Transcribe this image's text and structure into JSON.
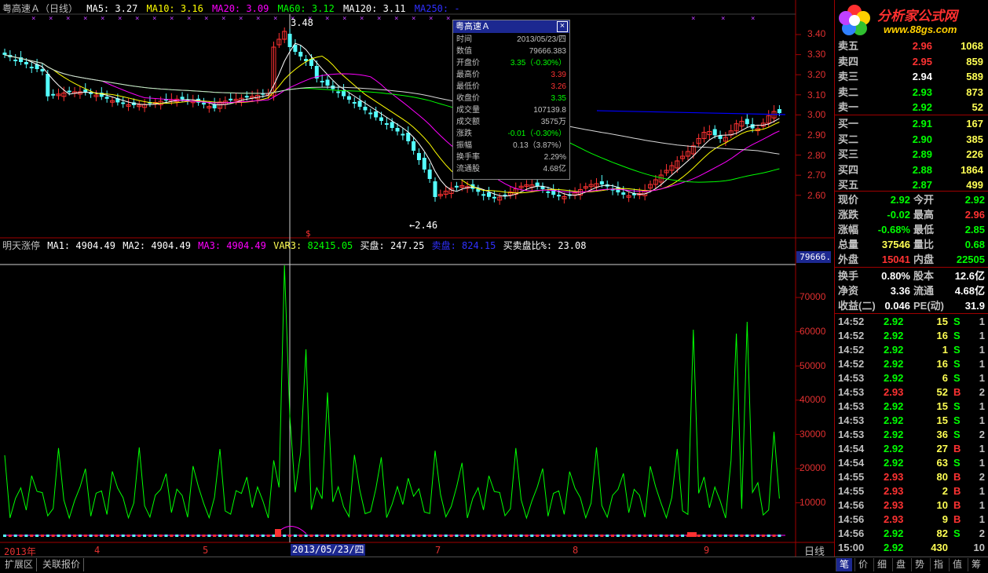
{
  "colors": {
    "up": "#ff3232",
    "down": "#54ffff",
    "ma5": "#ffffff",
    "ma10": "#ffff00",
    "ma20": "#ff00ff",
    "ma60": "#00ff00",
    "ma120": "#ffffff",
    "ma250": "#0000ff",
    "grid": "#a00000"
  },
  "header": {
    "stock": "粤高速Ａ（日线）",
    "ma5_label": "MA5:",
    "ma5": "3.27",
    "ma10_label": "MA10:",
    "ma10": "3.16",
    "ma20_label": "MA20:",
    "ma20": "3.09",
    "ma60_label": "MA60:",
    "ma60": "3.12",
    "ma120_label": "MA120:",
    "ma120": "3.11",
    "ma250_label": "MA250:",
    "ma250": "-"
  },
  "price_axis": [
    "3.40",
    "3.30",
    "3.20",
    "3.10",
    "3.00",
    "2.90",
    "2.80",
    "2.70",
    "2.60"
  ],
  "price_annotations": {
    "high": "3.48",
    "low": "←2.46",
    "marker": "$"
  },
  "indicator": {
    "name": "明天涨停",
    "ma1_label": "MA1:",
    "ma1": "4904.49",
    "ma2_label": "MA2:",
    "ma2": "4904.49",
    "ma3_label": "MA3:",
    "ma3": "4904.49",
    "var3_label": "VAR3:",
    "var3": "82415.05",
    "buy_label": "买盘:",
    "buy": "247.25",
    "sell_label": "卖盘:",
    "sell": "824.15",
    "ratio_label": "买卖盘比%:",
    "ratio": "23.08"
  },
  "indicator_axis": [
    "70000",
    "60000",
    "50000",
    "40000",
    "30000",
    "20000",
    "10000"
  ],
  "indicator_cursor_value": "79666.",
  "date_axis": {
    "year": "2013年",
    "m4": "4",
    "m5": "5",
    "cursor_date": "2013/05/23/四",
    "m7": "7",
    "m8": "8",
    "m9": "9",
    "period": "日线"
  },
  "popup": {
    "title": "粤高速Ａ",
    "close_icon": "×",
    "rows": [
      {
        "k": "时间",
        "v": "2013/05/23/四",
        "c": "#c0c0c0"
      },
      {
        "k": "数值",
        "v": "79666.383",
        "c": "#c0c0c0"
      },
      {
        "k": "开盘价",
        "v": "3.35（-0.30%）",
        "c": "#00ff00"
      },
      {
        "k": "最高价",
        "v": "3.39",
        "c": "#ff3232"
      },
      {
        "k": "最低价",
        "v": "3.26",
        "c": "#ff3232"
      },
      {
        "k": "收盘价",
        "v": "3.35",
        "c": "#00ff00"
      },
      {
        "k": "成交量",
        "v": "107139.8",
        "c": "#c0c0c0"
      },
      {
        "k": "成交额",
        "v": "3575万",
        "c": "#c0c0c0"
      },
      {
        "k": "涨跌",
        "v": "-0.01（-0.30%）",
        "c": "#00ff00"
      },
      {
        "k": "振幅",
        "v": "0.13（3.87%）",
        "c": "#c0c0c0"
      },
      {
        "k": "换手率",
        "v": "2.29%",
        "c": "#c0c0c0"
      },
      {
        "k": "流通股",
        "v": "4.68亿",
        "c": "#c0c0c0"
      }
    ]
  },
  "logo": {
    "text": "分析家公式网",
    "url": "www.88gs.com"
  },
  "orderbook": {
    "sell": [
      {
        "label": "卖五",
        "price": "2.96",
        "vol": "1068",
        "c": "#ff3232"
      },
      {
        "label": "卖四",
        "price": "2.95",
        "vol": "859",
        "c": "#ff3232"
      },
      {
        "label": "卖三",
        "price": "2.94",
        "vol": "589",
        "c": "#ffffff"
      },
      {
        "label": "卖二",
        "price": "2.93",
        "vol": "873",
        "c": "#00ff00"
      },
      {
        "label": "卖一",
        "price": "2.92",
        "vol": "52",
        "c": "#00ff00"
      }
    ],
    "buy": [
      {
        "label": "买一",
        "price": "2.91",
        "vol": "167",
        "c": "#00ff00"
      },
      {
        "label": "买二",
        "price": "2.90",
        "vol": "385",
        "c": "#00ff00"
      },
      {
        "label": "买三",
        "price": "2.89",
        "vol": "226",
        "c": "#00ff00"
      },
      {
        "label": "买四",
        "price": "2.88",
        "vol": "1864",
        "c": "#00ff00"
      },
      {
        "label": "买五",
        "price": "2.87",
        "vol": "499",
        "c": "#00ff00"
      }
    ]
  },
  "stats": [
    {
      "l1": "现价",
      "v1": "2.92",
      "c1": "#00ff00",
      "l2": "今开",
      "v2": "2.92",
      "c2": "#00ff00"
    },
    {
      "l1": "涨跌",
      "v1": "-0.02",
      "c1": "#00ff00",
      "l2": "最高",
      "v2": "2.96",
      "c2": "#ff3232"
    },
    {
      "l1": "涨幅",
      "v1": "-0.68%",
      "c1": "#00ff00",
      "l2": "最低",
      "v2": "2.85",
      "c2": "#00ff00"
    },
    {
      "l1": "总量",
      "v1": "37546",
      "c1": "#ffff54",
      "l2": "量比",
      "v2": "0.68",
      "c2": "#00ff00"
    },
    {
      "l1": "外盘",
      "v1": "15041",
      "c1": "#ff3232",
      "l2": "内盘",
      "v2": "22505",
      "c2": "#00ff00"
    }
  ],
  "stats2": [
    {
      "l1": "换手",
      "v1": "0.80%",
      "l2": "股本",
      "v2": "12.6亿"
    },
    {
      "l1": "净资",
      "v1": "3.36",
      "l2": "流通",
      "v2": "4.68亿"
    },
    {
      "l1": "收益(二)",
      "v1": "0.046",
      "l2": "PE(动)",
      "v2": "31.9"
    }
  ],
  "ticks": [
    {
      "t": "14:52",
      "p": "2.92",
      "v": "15",
      "s": "S",
      "n": "1"
    },
    {
      "t": "14:52",
      "p": "2.92",
      "v": "16",
      "s": "S",
      "n": "1"
    },
    {
      "t": "14:52",
      "p": "2.92",
      "v": "1",
      "s": "S",
      "n": "1"
    },
    {
      "t": "14:52",
      "p": "2.92",
      "v": "16",
      "s": "S",
      "n": "1"
    },
    {
      "t": "14:53",
      "p": "2.92",
      "v": "6",
      "s": "S",
      "n": "1"
    },
    {
      "t": "14:53",
      "p": "2.93",
      "v": "52",
      "s": "B",
      "n": "2"
    },
    {
      "t": "14:53",
      "p": "2.92",
      "v": "15",
      "s": "S",
      "n": "1"
    },
    {
      "t": "14:53",
      "p": "2.92",
      "v": "15",
      "s": "S",
      "n": "1"
    },
    {
      "t": "14:53",
      "p": "2.92",
      "v": "36",
      "s": "S",
      "n": "2"
    },
    {
      "t": "14:54",
      "p": "2.92",
      "v": "27",
      "s": "B",
      "n": "1"
    },
    {
      "t": "14:54",
      "p": "2.92",
      "v": "63",
      "s": "S",
      "n": "1"
    },
    {
      "t": "14:55",
      "p": "2.93",
      "v": "80",
      "s": "B",
      "n": "2"
    },
    {
      "t": "14:55",
      "p": "2.93",
      "v": "2",
      "s": "B",
      "n": "1"
    },
    {
      "t": "14:56",
      "p": "2.93",
      "v": "10",
      "s": "B",
      "n": "1"
    },
    {
      "t": "14:56",
      "p": "2.93",
      "v": "9",
      "s": "B",
      "n": "1"
    },
    {
      "t": "14:56",
      "p": "2.92",
      "v": "82",
      "s": "S",
      "n": "2"
    },
    {
      "t": "15:00",
      "p": "2.92",
      "v": "430",
      "s": "",
      "n": "10"
    }
  ],
  "bottom_tabs": {
    "t1": "扩展区",
    "t2": "关联报价"
  },
  "right_tabs": [
    "笔",
    "价",
    "细",
    "盘",
    "势",
    "指",
    "值",
    "筹"
  ]
}
